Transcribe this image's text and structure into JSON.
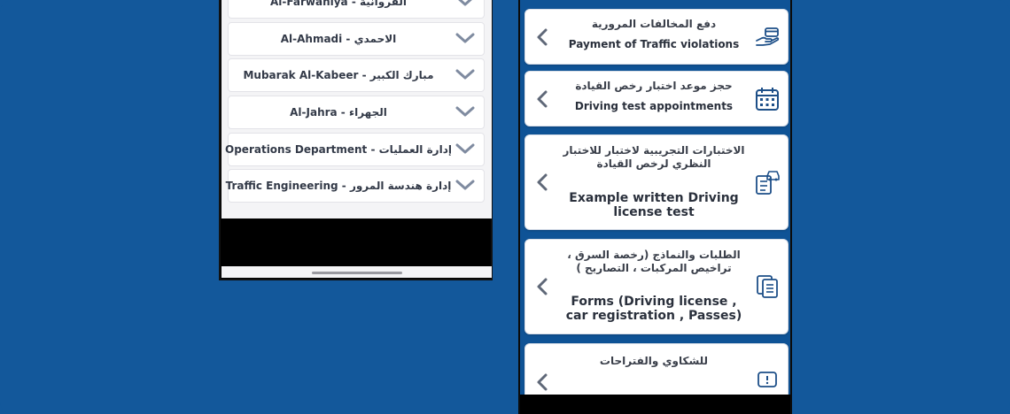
{
  "left_panel": {
    "regions": [
      {
        "label": "Al-Farwaniya - الفروانية"
      },
      {
        "label": "Al-Ahmadi - الاحمدي"
      },
      {
        "label": "Mubarak Al-Kabeer - مبارك الكبير"
      },
      {
        "label": "Al-Jahra - الجهراء"
      },
      {
        "label": "Operations Department - إدارة العمليات"
      },
      {
        "label": "Traffic Engineering - إدارة هندسة المرور"
      }
    ]
  },
  "right_panel": {
    "services": [
      {
        "arabic": "دفع المخالفات المرورية",
        "english": "Payment of Traffic violations",
        "icon": "hand-card-icon"
      },
      {
        "arabic": "حجز موعد اختبار رخص القيادة",
        "english": "Driving test appointments",
        "icon": "calendar-icon"
      },
      {
        "arabic": "الاختبارات التجريبية لاختبار للاختبار النظري لرخص القيادة",
        "english": "Example written Driving license test",
        "icon": "checklist-car-icon"
      },
      {
        "arabic": "الطلبات والنماذج (رخصة السرق ، تراخيص المركبات ، التصاريح )",
        "english": "Forms (Driving license , car registration , Passes)",
        "icon": "documents-icon"
      },
      {
        "arabic": "للشكاوي والفتراحات",
        "english": "",
        "icon": "complaint-icon"
      }
    ]
  },
  "colors": {
    "background": "#13589b",
    "chevron": "#7f8ba0",
    "card_chevron": "#5f6878",
    "icon": "#1d4f88"
  }
}
